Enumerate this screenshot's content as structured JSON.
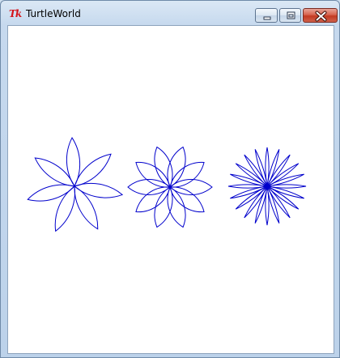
{
  "window": {
    "title": "TurtleWorld",
    "app_icon_text": "Tk"
  },
  "titlebar_buttons": {
    "minimize": "minimize",
    "maximize": "maximize",
    "close": "close"
  },
  "canvas": {
    "background": "#ffffff",
    "stroke_color": "#0000cc",
    "flowers": [
      {
        "petals": 7,
        "petal_angle_deg": 60
      },
      {
        "petals": 10,
        "petal_angle_deg": 80
      },
      {
        "petals": 20,
        "petal_angle_deg": 20
      }
    ]
  }
}
